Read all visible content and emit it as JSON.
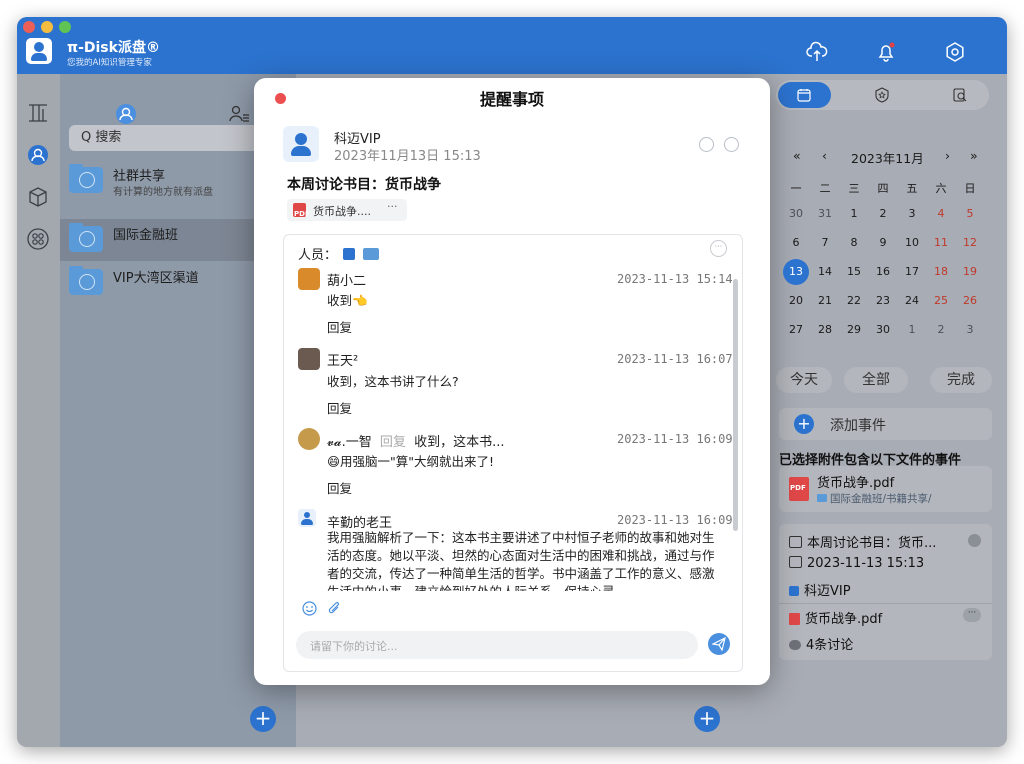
{
  "window": {
    "app_title": "π-Disk派盘®",
    "app_subtitle": "您我的AI知识管理专家"
  },
  "folders": {
    "search_placeholder": "Q 搜索",
    "items": [
      {
        "name": "社群共享",
        "desc": "有计算的地方就有派盘"
      },
      {
        "name": "国际金融班",
        "desc": ""
      },
      {
        "name": "VIP大湾区渠道",
        "desc": ""
      }
    ]
  },
  "calendar": {
    "prev_year": "«",
    "prev_month": "‹",
    "month_label": "2023年11月",
    "next_month": "›",
    "next_year": "»",
    "weekdays": [
      "一",
      "二",
      "三",
      "四",
      "五",
      "六",
      "日"
    ],
    "days": [
      [
        "30",
        "31",
        "1",
        "2",
        "3",
        "4",
        "5"
      ],
      [
        "6",
        "7",
        "8",
        "9",
        "10",
        "11",
        "12"
      ],
      [
        "13",
        "14",
        "15",
        "16",
        "17",
        "18",
        "19"
      ],
      [
        "20",
        "21",
        "22",
        "23",
        "24",
        "25",
        "26"
      ],
      [
        "27",
        "28",
        "29",
        "30",
        "1",
        "2",
        "3"
      ]
    ],
    "filters": [
      "今天",
      "全部",
      "完成"
    ],
    "add_event": "添加事件",
    "section_title": "已选择附件包含以下文件的事件",
    "file_name": "货币战争.pdf",
    "file_path": "国际金融班/书籍共享/",
    "event": {
      "title": "本周讨论书目：货币...",
      "time": "2023-11-13 15:13",
      "owner": "科迈VIP",
      "attachment": "货币战争.pdf",
      "discussions": "4条讨论"
    }
  },
  "modal": {
    "title": "提醒事项",
    "author": "科迈VIP",
    "author_time": "2023年11月13日 15:13",
    "topic": "本周讨论书目：货币战争",
    "attachment": "货币战争....",
    "attachment_more": "···",
    "people_label": "人员：",
    "more": "···",
    "messages": [
      {
        "name": "葫小二",
        "time": "2023-11-13 15:14",
        "text": "收到👈",
        "reply": "回复"
      },
      {
        "name": "王天²",
        "time": "2023-11-13 16:07",
        "text": "收到，这本书讲了什么?",
        "reply": "回复"
      },
      {
        "name": "𝓿𝓪.一智",
        "reply_tag": "回复",
        "quote": "收到，这本书...",
        "time": "2023-11-13 16:09",
        "text": "😄用强脑一\"算\"大纲就出来了!",
        "reply": "回复"
      },
      {
        "name": "辛勤的老王",
        "time": "2023-11-13 16:09",
        "text": "我用强脑解析了一下：这本书主要讲述了中村恒子老师的故事和她对生活的态度。她以平淡、坦然的心态面对生活中的困难和挑战，通过与作者的交流，传达了一种简单生活的哲学。书中涵盖了工作的意义、感激生活中的小事、建立恰到好处的人际关系、保持心灵"
      }
    ],
    "input_placeholder": "请留下你的讨论..."
  }
}
